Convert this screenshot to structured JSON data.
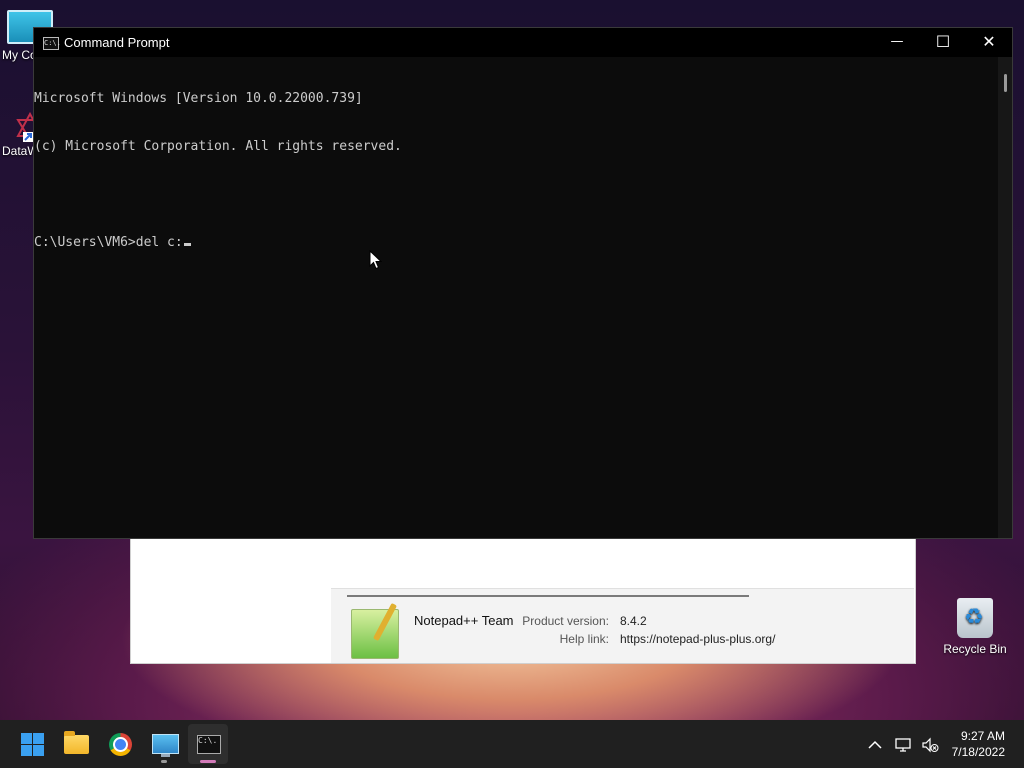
{
  "desktop": {
    "icons": [
      {
        "label": "My Co"
      },
      {
        "label": "DataW"
      },
      {
        "label": "Recycle Bin"
      }
    ]
  },
  "notepad_about": {
    "team": "Notepad++ Team",
    "product_version_label": "Product version:",
    "product_version": "8.4.2",
    "help_link_label": "Help link:",
    "help_link": "https://notepad-plus-plus.org/"
  },
  "cmd_window": {
    "title": "Command Prompt",
    "icon_text": "C:\\.",
    "minimize": "—",
    "maximize": "☐",
    "close": "✕",
    "lines": [
      "Microsoft Windows [Version 10.0.22000.739]",
      "(c) Microsoft Corporation. All rights reserved.",
      "",
      "C:\\Users\\VM6>del c:"
    ]
  },
  "taskbar": {
    "apps": [
      {
        "name": "Start"
      },
      {
        "name": "File Explorer"
      },
      {
        "name": "Google Chrome"
      },
      {
        "name": "Remote Desktop"
      },
      {
        "name": "Command Prompt"
      }
    ],
    "tray": {
      "chevron": "^",
      "time": "9:27 AM",
      "date": "7/18/2022"
    }
  }
}
